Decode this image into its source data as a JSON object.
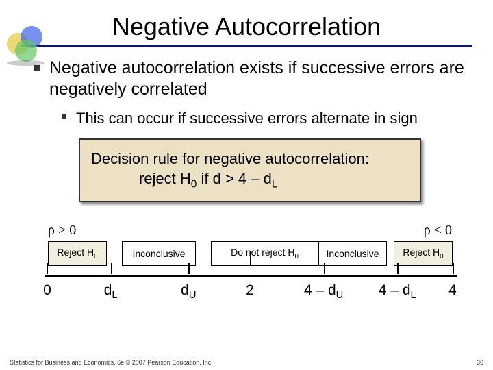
{
  "title": "Negative Autocorrelation",
  "bullet1": "Negative autocorrelation exists if successive errors are negatively correlated",
  "bullet2": "This can occur if successive errors alternate in sign",
  "rule": {
    "line1": "Decision rule for negative autocorrelation:",
    "line2_prefix": "reject H",
    "line2_sub": "0",
    "line2_mid": " if d > 4 – d",
    "line2_sub2": "L"
  },
  "rho": {
    "left": "ρ > 0",
    "right": "ρ < 0"
  },
  "regions": {
    "reject_prefix": "Reject H",
    "reject_sub": "0",
    "inconclusive": "Inconclusive",
    "donot_prefix": "Do not reject H",
    "donot_sub": "0"
  },
  "axis": {
    "p0": "0",
    "p1_a": "d",
    "p1_b": "L",
    "p2_a": "d",
    "p2_b": "U",
    "p3": "2",
    "p4_a": "4 – d",
    "p4_b": "U",
    "p5_a": "4 – d",
    "p5_b": "L",
    "p6": "4"
  },
  "footer": {
    "left": "Statistics for Business and Economics, 6e © 2007 Pearson Education, Inc.",
    "right": "36"
  }
}
